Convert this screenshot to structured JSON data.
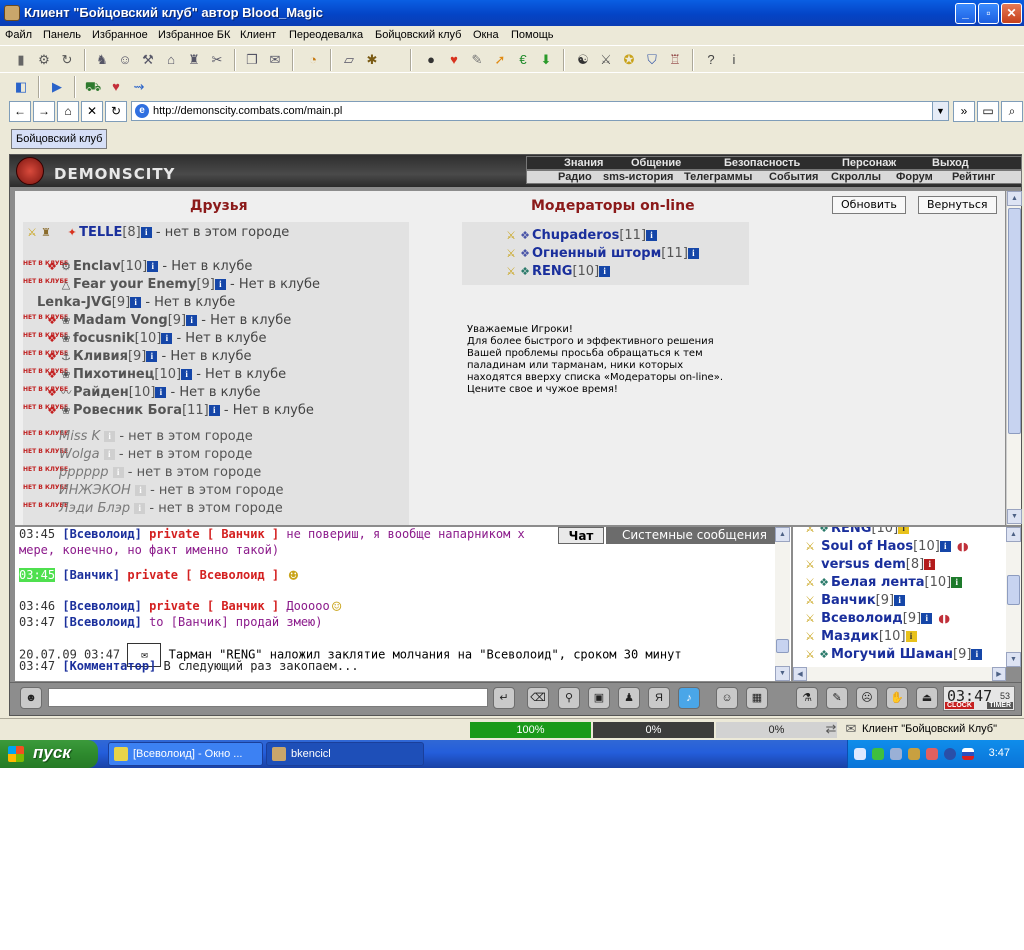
{
  "window": {
    "title": "Клиент \"Бойцовский клуб\" автор Blood_Magic"
  },
  "menu": [
    "Файл",
    "Панель",
    "Избранное",
    "Избранное БК",
    "Клиент",
    "Переодевалка",
    "Бойцовский клуб",
    "Окна",
    "Помощь"
  ],
  "address": {
    "url": "http://demonscity.combats.com/main.pl"
  },
  "page_tab": "Бойцовский клуб",
  "game": {
    "logo": "DEMONSCITY",
    "nav_top": [
      "Знания",
      "Общение",
      "Безопасность",
      "Персонаж",
      "Выход"
    ],
    "nav_bottom": [
      "Радио",
      "sms-история",
      "Телеграммы",
      "События",
      "Скроллы",
      "Форум",
      "Рейтинг"
    ],
    "friends_title": "Друзья",
    "mods_title": "Модераторы on-line",
    "btn_refresh": "Обновить",
    "btn_back": "Вернуться",
    "club_badge": "НЕТ В КЛУБЕ",
    "friends_top": {
      "nick": "TELLE",
      "level": "[8]",
      "status": "- нет в этом городе"
    },
    "friends": [
      {
        "nick": "Enclav",
        "level": "[10]",
        "status": "- Нет в клубе"
      },
      {
        "nick": "Fear your Enemy",
        "level": "[9]",
        "status": "- Нет в клубе"
      },
      {
        "nick": "Lenka-JVG",
        "level": "[9]",
        "status": "- Нет в клубе"
      },
      {
        "nick": "Madam Vong",
        "level": "[9]",
        "status": "- Нет в клубе"
      },
      {
        "nick": "focusnik",
        "level": "[10]",
        "status": "- Нет в клубе"
      },
      {
        "nick": "Кливия",
        "level": "[9]",
        "status": "- Нет в клубе"
      },
      {
        "nick": "Пихотинец",
        "level": "[10]",
        "status": "- Нет в клубе"
      },
      {
        "nick": "Райден",
        "level": "[10]",
        "status": "- Нет в клубе"
      },
      {
        "nick": "Ровесник Бога",
        "level": "[11]",
        "status": "- Нет в клубе"
      }
    ],
    "friends_offline": [
      {
        "nick": "Miss K",
        "status": "- нет в этом городе"
      },
      {
        "nick": "Wolga",
        "status": "- нет в этом городе"
      },
      {
        "nick": "pppppp",
        "status": "- нет в этом городе"
      },
      {
        "nick": "ИНЖЭКОН",
        "status": "- нет в этом городе"
      },
      {
        "nick": "Лэди Блэр",
        "status": "- нет в этом городе"
      }
    ],
    "moderators": [
      {
        "nick": "Chupaderos",
        "level": "[11]"
      },
      {
        "nick": "Огненный шторм",
        "level": "[11]"
      },
      {
        "nick": "RENG",
        "level": "[10]"
      }
    ],
    "note": [
      "Уважаемые Игроки!",
      "Для более быстрого и эффективного решения",
      "Вашей проблемы просьба обращаться к тем",
      "паладинам или тарманам, ники которых",
      "находятся вверху списка «Модераторы on-line».",
      "Цените свое и чужое время!"
    ]
  },
  "chat": {
    "tabs": [
      "Чат",
      "Системные сообщения"
    ],
    "lines": [
      {
        "time": "03:45",
        "nick": "[Всеволоид]",
        "priv": "private [ Ванчик ]",
        "msg": "не повериш, я вообще напарником х"
      },
      {
        "cont": "мере, конечно, но факт именно такой)"
      },
      {
        "time": "03:45",
        "nick": "[Ванчик]",
        "priv": "private [ Всеволоид ]",
        "msg": ""
      },
      {
        "time": "03:46",
        "nick": "[Всеволоид]",
        "priv": "private [ Ванчик ]",
        "msg": "Дооооо"
      },
      {
        "time": "03:47",
        "nick": "[Всеволоид]",
        "to": "to [Ванчик]",
        "msg": "продай змею)"
      },
      {
        "date": "20.07.09 03:47",
        "sys": "Тарман \"RENG\" наложил заклятие молчания на \"Всеволоид\", сроком 30 минут"
      },
      {
        "time": "03:47",
        "nick": "[Комментатор]",
        "msg": "В следующий раз закопаем..."
      }
    ]
  },
  "users": [
    {
      "nick": "RENG",
      "level": "[10]"
    },
    {
      "nick": "Soul of Haos",
      "level": "[10]"
    },
    {
      "nick": "versus dem",
      "level": "[8]"
    },
    {
      "nick": "Белая лента",
      "level": "[10]"
    },
    {
      "nick": "Ванчик",
      "level": "[9]"
    },
    {
      "nick": "Всеволоид",
      "level": "[9]"
    },
    {
      "nick": "Маздик",
      "level": "[10]"
    },
    {
      "nick": "Могучий Шаман",
      "level": "[9]"
    }
  ],
  "clock": {
    "time": "03:47",
    "sec": "53",
    "clock_label": "CLOCK",
    "timer_label": "TIMER"
  },
  "statusbar": {
    "p1": "100%",
    "p1_value": 1.0,
    "p2": "0%",
    "p3": "0%",
    "text": "Клиент \"Бойцовский Клуб\""
  },
  "taskbar": {
    "start": "пуск",
    "task1": "[Всеволоид] - Окно ...",
    "task2": "bkencicl",
    "time": "3:47"
  },
  "colors": {
    "title_blue": "#0444c6",
    "private_red": "#d42020",
    "nick_blue": "#1a2f9c",
    "section_red": "#8b1a1a"
  }
}
